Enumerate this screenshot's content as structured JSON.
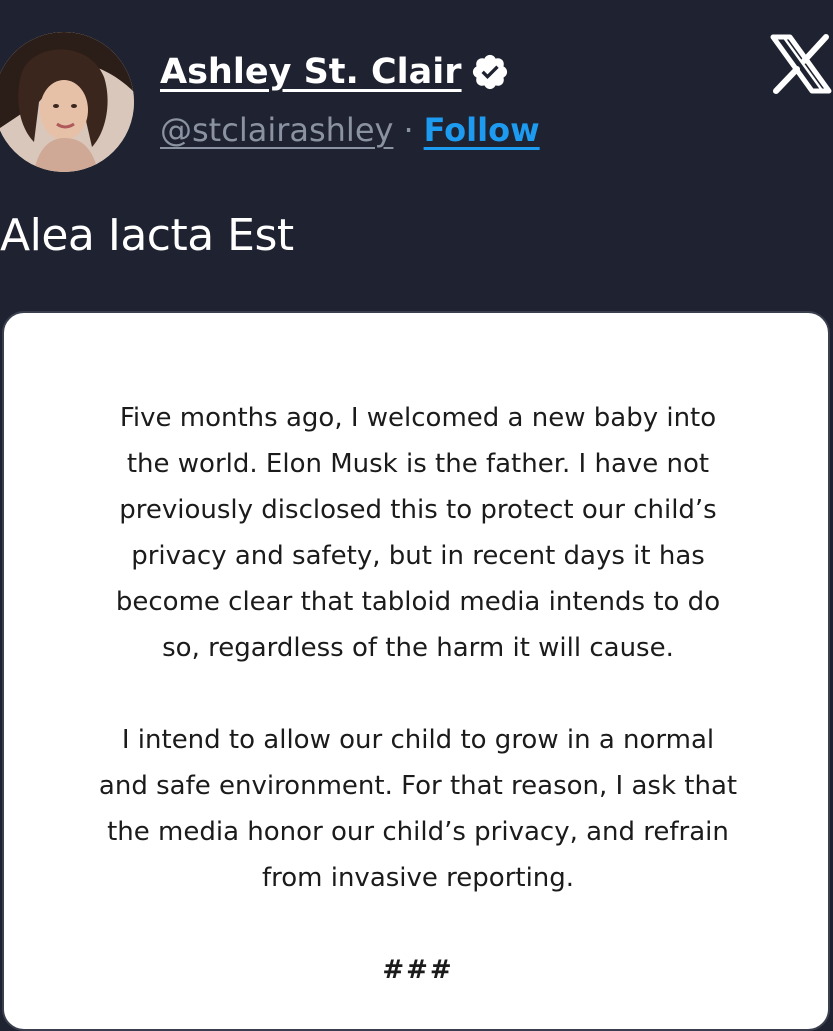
{
  "header": {
    "display_name": "Ashley St. Clair",
    "handle": "@stclairashley",
    "separator": "·",
    "follow_label": "Follow"
  },
  "icons": {
    "verified": "verified-badge-icon",
    "brand": "x-logo-icon",
    "avatar": "profile-photo"
  },
  "tweet": {
    "text": "Alea Iacta Est"
  },
  "statement": {
    "paragraph_1": "Five months ago, I welcomed a new baby into\nthe world. Elon Musk is the father. I have not\npreviously disclosed this to protect our child’s\nprivacy and safety, but in recent days it has\nbecome clear that tabloid media intends to do\nso, regardless of the harm it will cause.",
    "paragraph_2": "I intend to allow our child to grow in a normal\nand safe environment. For that reason, I ask that\nthe media honor our child’s privacy, and refrain\nfrom invasive reporting.",
    "closing": "###"
  },
  "colors": {
    "background": "#1f2230",
    "follow_link": "#1d9bf0",
    "handle": "#8b93a2",
    "card": "#ffffff"
  }
}
